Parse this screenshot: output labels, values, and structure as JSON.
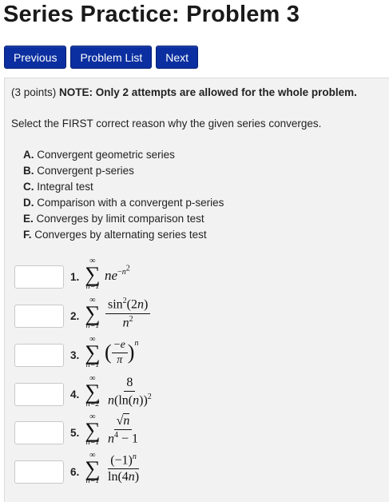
{
  "page": {
    "title": "Series Practice: Problem 3"
  },
  "nav": {
    "previous": "Previous",
    "problem_list": "Problem List",
    "next": "Next"
  },
  "problem": {
    "points": "(3 points)",
    "note": "NOTE: Only 2 attempts are allowed for the whole problem.",
    "instruction": "Select the FIRST correct reason why the given series converges.",
    "choices": [
      {
        "letter": "A.",
        "text": "Convergent geometric series"
      },
      {
        "letter": "B.",
        "text": "Convergent p-series"
      },
      {
        "letter": "C.",
        "text": "Integral test"
      },
      {
        "letter": "D.",
        "text": "Comparison with a convergent p-series"
      },
      {
        "letter": "E.",
        "text": "Converges by limit comparison test"
      },
      {
        "letter": "F.",
        "text": "Converges by alternating series test"
      }
    ],
    "series": [
      {
        "num": "1.",
        "upper": "∞",
        "lower": "n=1",
        "answer": ""
      },
      {
        "num": "2.",
        "upper": "∞",
        "lower": "n=1",
        "answer": ""
      },
      {
        "num": "3.",
        "upper": "∞",
        "lower": "n=1",
        "answer": ""
      },
      {
        "num": "4.",
        "upper": "∞",
        "lower": "n=2",
        "answer": ""
      },
      {
        "num": "5.",
        "upper": "∞",
        "lower": "n=1",
        "answer": ""
      },
      {
        "num": "6.",
        "upper": "∞",
        "lower": "n=1",
        "answer": ""
      }
    ]
  }
}
